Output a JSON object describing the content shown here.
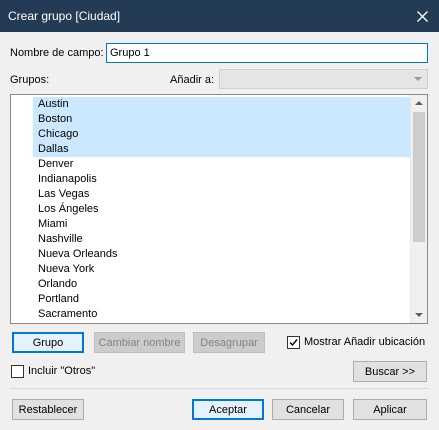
{
  "window": {
    "title": "Crear grupo [Ciudad]"
  },
  "field": {
    "label": "Nombre de campo:",
    "value": "Grupo 1"
  },
  "groups_label": "Grupos:",
  "add_to": {
    "label": "Añadir a:",
    "value": ""
  },
  "list": {
    "items": [
      {
        "label": "Austin",
        "selected": true
      },
      {
        "label": "Boston",
        "selected": true
      },
      {
        "label": "Chicago",
        "selected": true
      },
      {
        "label": "Dallas",
        "selected": true
      },
      {
        "label": "Denver",
        "selected": false
      },
      {
        "label": "Indianapolis",
        "selected": false
      },
      {
        "label": "Las Vegas",
        "selected": false
      },
      {
        "label": "Los Ángeles",
        "selected": false
      },
      {
        "label": "Miami",
        "selected": false
      },
      {
        "label": "Nashville",
        "selected": false
      },
      {
        "label": "Nueva Orleands",
        "selected": false
      },
      {
        "label": "Nueva York",
        "selected": false
      },
      {
        "label": "Orlando",
        "selected": false
      },
      {
        "label": "Portland",
        "selected": false
      },
      {
        "label": "Sacramento",
        "selected": false
      }
    ]
  },
  "actions": {
    "group": "Grupo",
    "rename": "Cambiar nombre",
    "ungroup": "Desagrupar"
  },
  "show_add_location": {
    "label": "Mostrar Añadir ubicación",
    "checked": true
  },
  "include_others": {
    "label": "Incluir \"Otros\"",
    "checked": false
  },
  "find": "Buscar >>",
  "footer": {
    "reset": "Restablecer",
    "ok": "Aceptar",
    "cancel": "Cancelar",
    "apply": "Aplicar"
  },
  "icons": {
    "close": "close-icon",
    "combo": "chevron-down-icon",
    "check": "checkmark-icon"
  }
}
